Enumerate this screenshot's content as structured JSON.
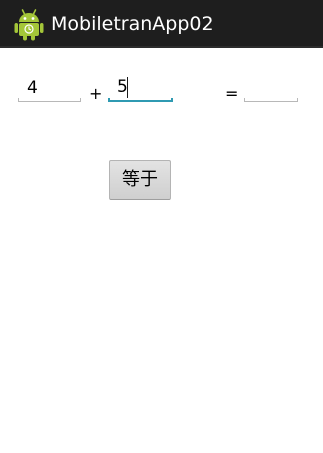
{
  "app_bar": {
    "title": "MobiletranApp02",
    "icon": "android-robot-icon"
  },
  "form": {
    "first_operand": "4",
    "plus_sign": "+",
    "second_operand": "5",
    "equals_sign": "=",
    "result": ""
  },
  "equals_button": {
    "label": "等于"
  },
  "colors": {
    "action_bar": "#1e1e1e",
    "focus_accent": "#2f9ab2",
    "android_green": "#a4c639"
  }
}
